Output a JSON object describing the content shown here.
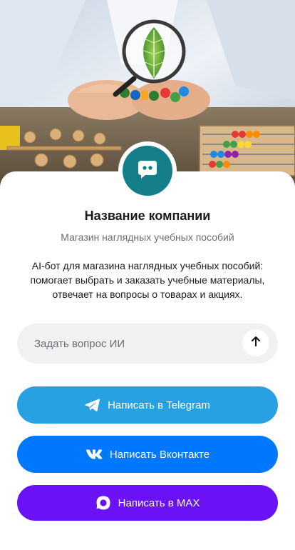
{
  "company": {
    "name": "Название компании",
    "subtitle": "Магазин наглядных учебных пособий",
    "description": "AI-бот для магазина наглядных учебных пособий: помогает выбрать и заказать учебные материалы, отвечает на вопросы о товарах и акциях."
  },
  "ask": {
    "placeholder": "Задать вопрос ИИ",
    "send_icon": "arrow-up-icon"
  },
  "buttons": {
    "telegram": {
      "label": "Написать в Telegram",
      "icon": "telegram-icon",
      "color": "#27a1e2"
    },
    "vk": {
      "label": "Написать Вконтакте",
      "icon": "vk-icon",
      "color": "#0077ff"
    },
    "max": {
      "label": "Написать в MAX",
      "icon": "max-icon",
      "color": "#6a11f5"
    }
  },
  "colors": {
    "avatar": "#147f88",
    "input_bg": "#f1f1f3"
  }
}
